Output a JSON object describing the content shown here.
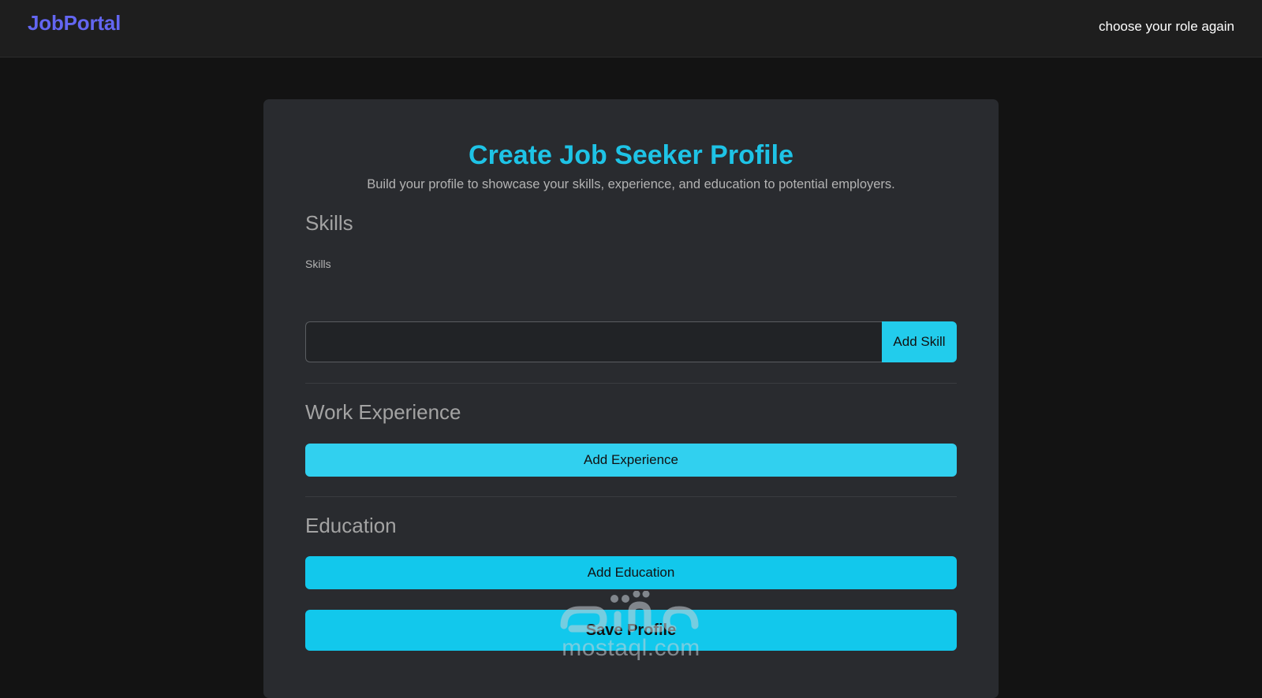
{
  "navbar": {
    "brand": "JobPortal",
    "role_link": "choose your role again",
    "brand_color": "#6366f1"
  },
  "form": {
    "title": "Create Job Seeker Profile",
    "subtitle": "Build your profile to showcase your skills, experience, and education to potential employers.",
    "skills": {
      "heading": "Skills",
      "label": "Skills",
      "input_value": "",
      "add_label": "Add Skill"
    },
    "experience": {
      "heading": "Work Experience",
      "add_label": "Add Experience"
    },
    "education": {
      "heading": "Education",
      "add_label": "Add Education"
    },
    "save_label": "Save Profile",
    "accent_color": "#1ec3e6"
  },
  "watermark": {
    "text": "mostaql.com"
  }
}
